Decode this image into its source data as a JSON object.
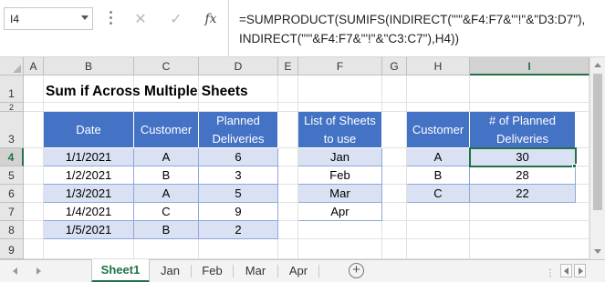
{
  "formula_bar": {
    "name_box": "I4",
    "fx_label": "fx",
    "cancel_glyph": "✕",
    "enter_glyph": "✓",
    "formula_line1": "=SUMPRODUCT(SUMIFS(INDIRECT(\"'\"&F4:F7&\"'!\"&\"D3:D7\"),",
    "formula_line2": "INDIRECT(\"'\"&F4:F7&\"'!\"&\"C3:C7\"),H4))"
  },
  "columns": [
    "A",
    "B",
    "C",
    "D",
    "E",
    "F",
    "G",
    "H",
    "I"
  ],
  "rows": [
    "1",
    "2",
    "3",
    "4",
    "5",
    "6",
    "7",
    "8",
    "9"
  ],
  "selected": {
    "column": "I",
    "row": "4"
  },
  "title": "Sum if Across Multiple Sheets",
  "delivery_table": {
    "headers": [
      "Date",
      "Customer",
      "Planned Deliveries"
    ],
    "rows": [
      [
        "1/1/2021",
        "A",
        "6"
      ],
      [
        "1/2/2021",
        "B",
        "3"
      ],
      [
        "1/3/2021",
        "A",
        "5"
      ],
      [
        "1/4/2021",
        "C",
        "9"
      ],
      [
        "1/5/2021",
        "B",
        "2"
      ]
    ]
  },
  "sheets_table": {
    "header": "List of Sheets to use",
    "items": [
      "Jan",
      "Feb",
      "Mar",
      "Apr"
    ]
  },
  "summary_table": {
    "headers": [
      "Customer",
      "# of Planned Deliveries"
    ],
    "rows": [
      [
        "A",
        "30"
      ],
      [
        "B",
        "28"
      ],
      [
        "C",
        "22"
      ]
    ]
  },
  "tabs": {
    "active": "Sheet1",
    "items": [
      "Sheet1",
      "Jan",
      "Feb",
      "Mar",
      "Apr"
    ],
    "add_glyph": "+",
    "more_glyph": "⋮"
  },
  "colors": {
    "header_blue": "#4472c4",
    "band_blue": "#d9e1f2",
    "excel_green": "#217346"
  }
}
